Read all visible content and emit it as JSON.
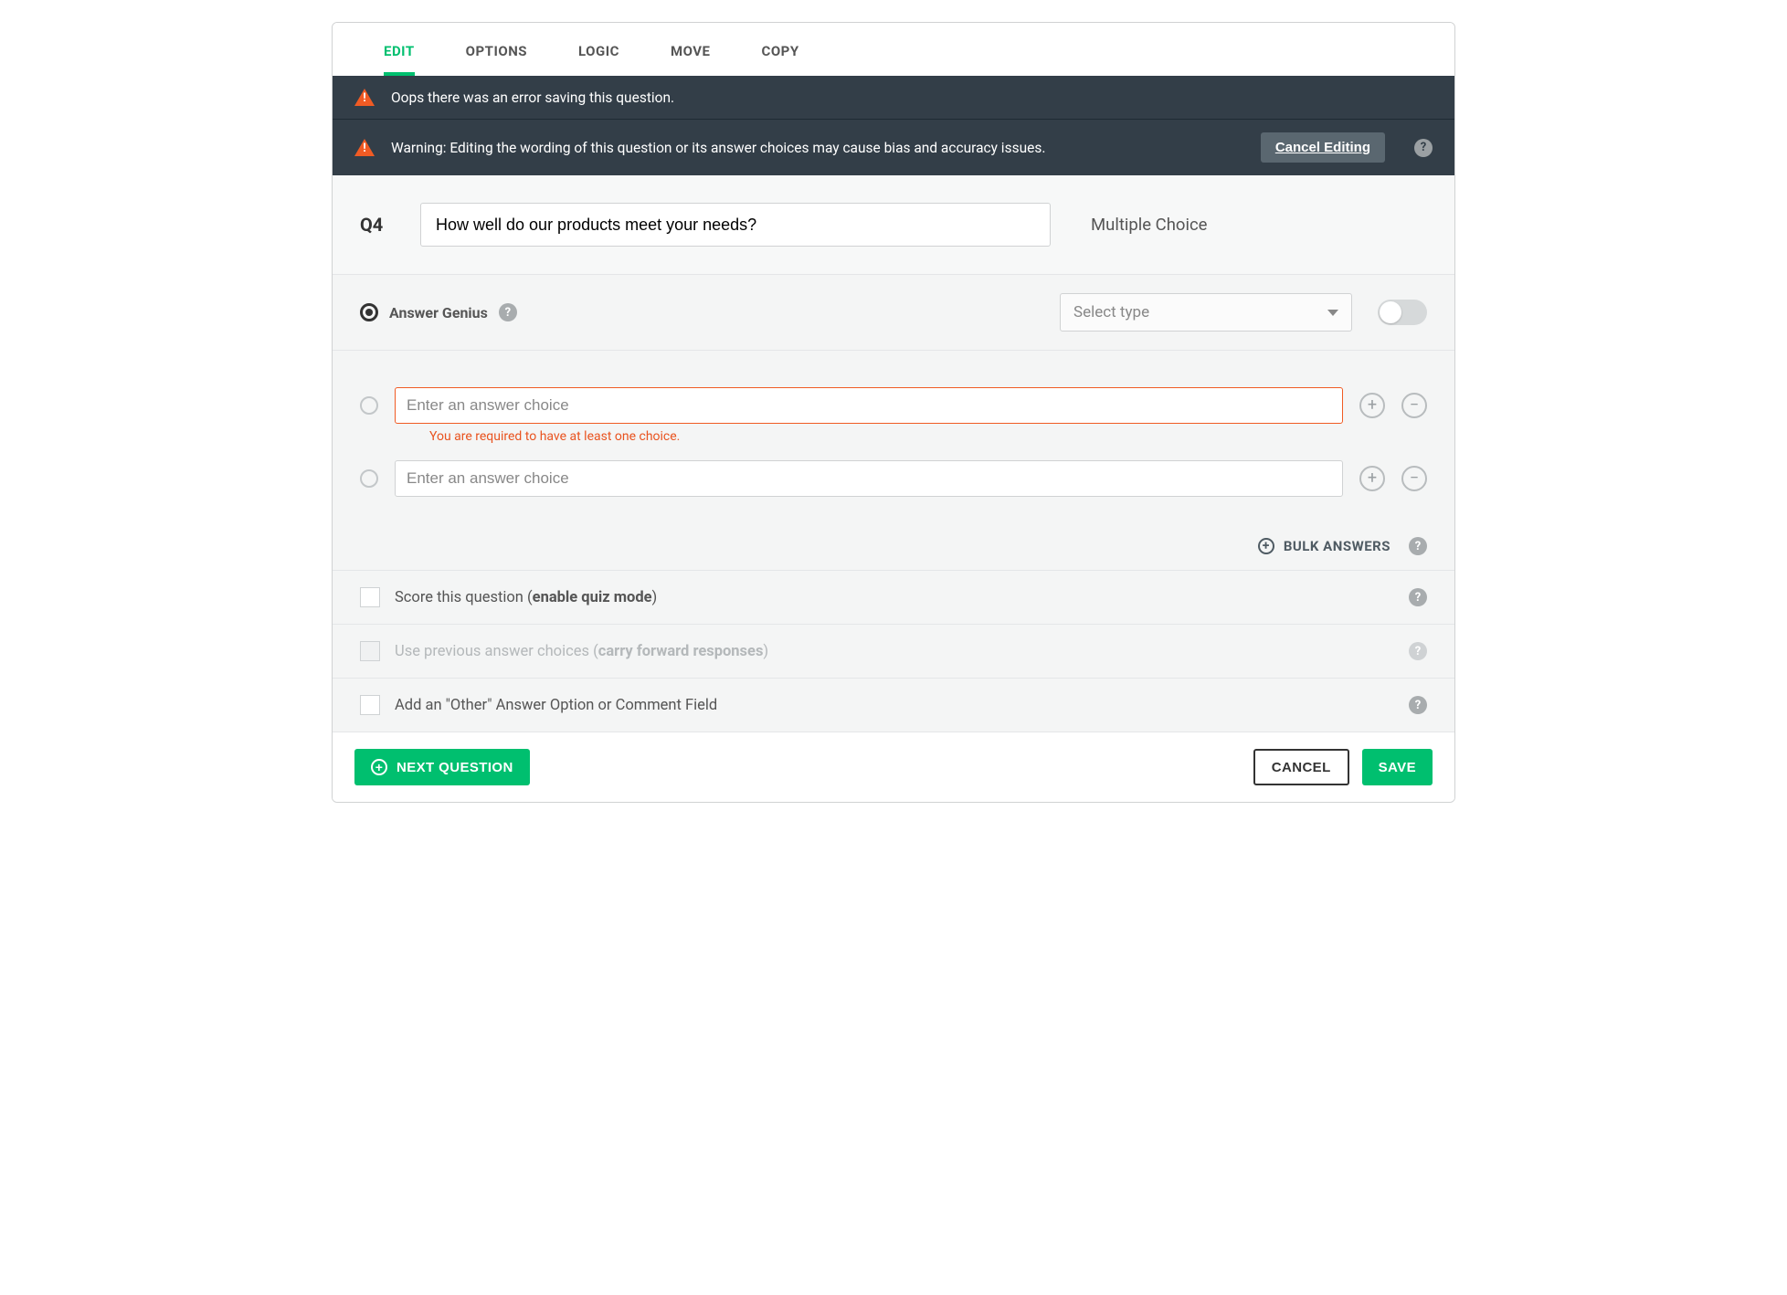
{
  "tabs": {
    "edit": "EDIT",
    "options": "OPTIONS",
    "logic": "LOGIC",
    "move": "MOVE",
    "copy": "COPY"
  },
  "banners": {
    "error": "Oops there was an error saving this question.",
    "warning": "Warning: Editing the wording of this question or its answer choices may cause bias and accuracy issues.",
    "cancel_editing": "Cancel Editing"
  },
  "question": {
    "number": "Q4",
    "text": "How well do our products meet your needs?",
    "type": "Multiple Choice"
  },
  "genius": {
    "label": "Answer Genius",
    "select_placeholder": "Select type"
  },
  "answers": {
    "placeholder": "Enter an answer choice",
    "error": "You are required to have at least one choice.",
    "bulk_label": "BULK ANSWERS"
  },
  "options": {
    "score_prefix": "Score this question (",
    "score_bold": "enable quiz mode",
    "close_paren": ")",
    "carry_prefix": "Use previous answer choices (",
    "carry_bold": "carry forward responses",
    "other": "Add an \"Other\" Answer Option or Comment Field"
  },
  "footer": {
    "next": "NEXT QUESTION",
    "cancel": "CANCEL",
    "save": "SAVE"
  }
}
